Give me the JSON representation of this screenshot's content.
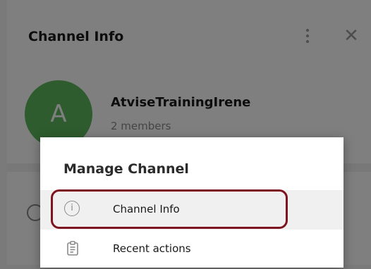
{
  "header": {
    "title": "Channel Info",
    "more_icon": "kebab-vertical-icon",
    "close_glyph": "✕"
  },
  "channel": {
    "avatar_letter": "A",
    "avatar_color": "#5cb85c",
    "name": "AtviseTrainingIrene",
    "members": "2 members"
  },
  "menu": {
    "title": "Manage Channel",
    "items": [
      {
        "label": "Channel Info",
        "icon": "info-icon",
        "icon_glyph": "i",
        "selected": true
      },
      {
        "label": "Recent actions",
        "icon": "clipboard-icon"
      }
    ]
  },
  "colors": {
    "overlay": "rgba(0,0,0,0.5)",
    "highlight": "#7d1420",
    "selected_bg": "#f0f0f0"
  }
}
